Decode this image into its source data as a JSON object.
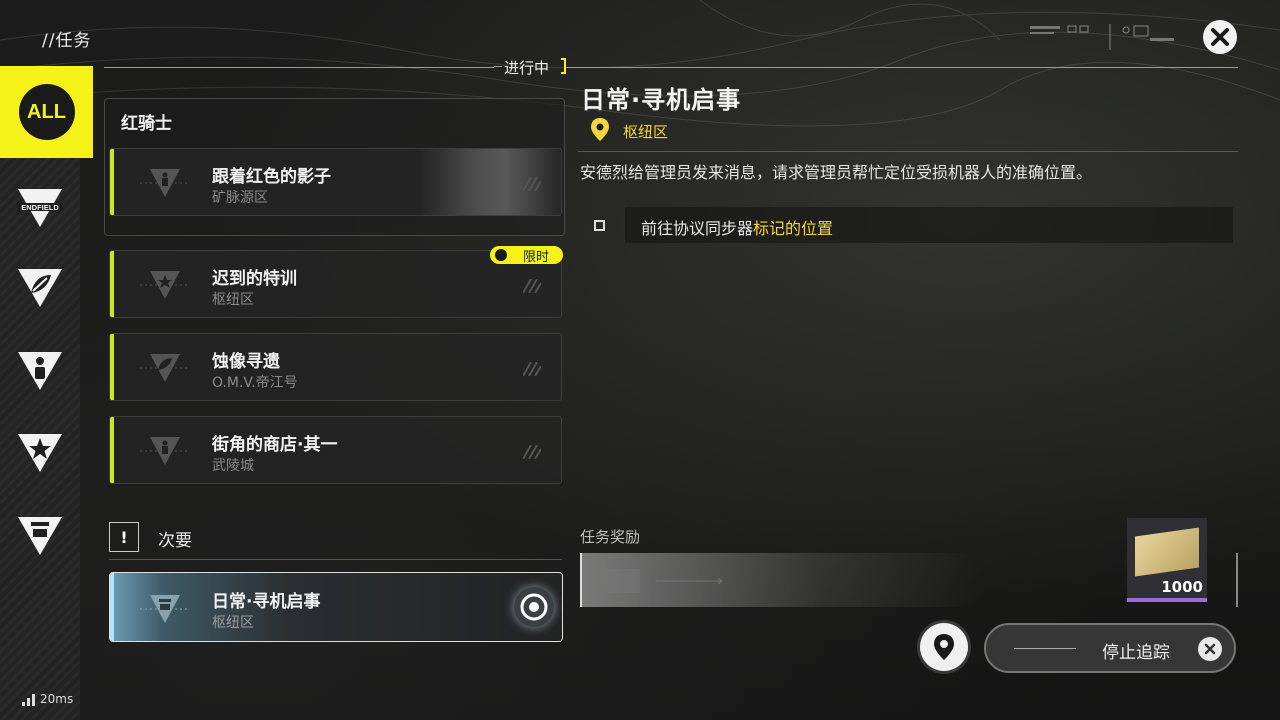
{
  "header": {
    "breadcrumb": "//任务"
  },
  "sidebar": {
    "items": [
      {
        "label": "ALL",
        "icon": "all-icon"
      },
      {
        "label": "ENDFIELD",
        "icon": "endfield-icon"
      },
      {
        "label": "",
        "icon": "leaf-triangle-icon"
      },
      {
        "label": "",
        "icon": "person-triangle-icon"
      },
      {
        "label": "",
        "icon": "star-triangle-icon"
      },
      {
        "label": "",
        "icon": "building-triangle-icon"
      }
    ]
  },
  "quests": {
    "in_progress_label": "进行中",
    "group": {
      "title": "红骑士"
    },
    "cards": [
      {
        "title": "跟着红色的影子",
        "location": "矿脉源区",
        "deco": ""
      },
      {
        "title": "迟到的特训",
        "location": "枢纽区",
        "badge": "限时",
        "deco": ""
      },
      {
        "title": "蚀像寻遗",
        "location": "O.M.V.帝江号",
        "deco": ""
      },
      {
        "title": "街角的商店·其一",
        "location": "武陵城",
        "deco": ""
      }
    ],
    "secondary": {
      "icon": "!",
      "label": "次要",
      "selected": {
        "title": "日常·寻机启事",
        "location": "枢纽区"
      }
    }
  },
  "detail": {
    "title": "日常·寻机启事",
    "location": "枢纽区",
    "description": "安德烈给管理员发来消息，请求管理员帮忙定位受损机器人的准确位置。",
    "objective_prefix": "前往协议同步器",
    "objective_highlight": "标记的位置",
    "reward_label": "任务奖励",
    "reward_qty": "1000"
  },
  "buttons": {
    "stop_tracking": "停止追踪"
  },
  "status": {
    "ping": "20ms"
  },
  "colors": {
    "accent_yellow": "#f5f21a",
    "highlight_text": "#f5d53a",
    "green_bar": "#c7e82a"
  }
}
